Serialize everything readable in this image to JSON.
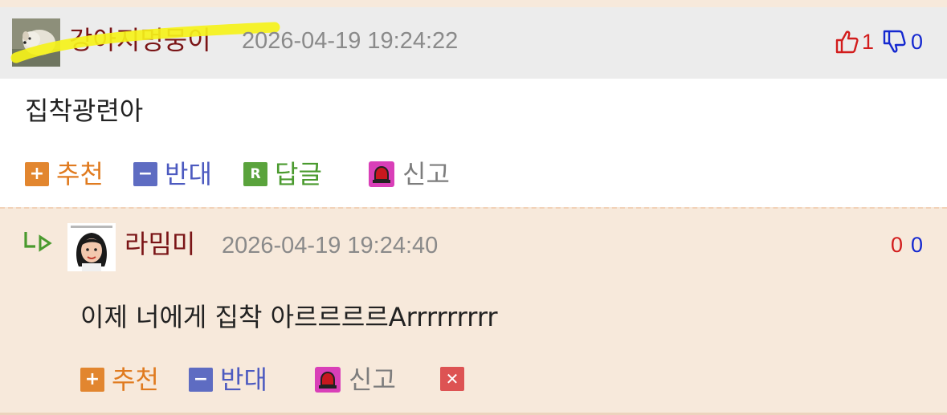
{
  "comment": {
    "author": "강아지멍뭉이",
    "timestamp": "2026-04-19 19:24:22",
    "upvotes": "1",
    "downvotes": "0",
    "text": "집착광련아",
    "actions": {
      "recommend": "추천",
      "oppose": "반대",
      "reply": "답글",
      "report": "신고"
    }
  },
  "reply": {
    "author": "라밈미",
    "timestamp": "2026-04-19 19:24:40",
    "upvotes": "0",
    "downvotes": "0",
    "text": "이제 너에게 집착 아르르르르Arrrrrrrrr",
    "actions": {
      "recommend": "추천",
      "oppose": "반대",
      "report": "신고"
    }
  },
  "colors": {
    "author": "#7a1416",
    "upvote": "#d21c1c",
    "downvote": "#1428d0",
    "recommend": "#e07b20",
    "oppose": "#4c5ac0",
    "reply": "#4a9a2e",
    "reply_background": "#f7e9db",
    "header_background": "#ececec",
    "highlight": "#f5f21a"
  },
  "icons": {
    "thumbs_up": "thumbs-up-icon",
    "thumbs_down": "thumbs-down-icon",
    "plus": "plus-icon",
    "minus": "minus-icon",
    "reply": "reply-r-icon",
    "report": "siren-icon",
    "delete": "close-icon",
    "reply_indent": "reply-arrow-icon"
  }
}
